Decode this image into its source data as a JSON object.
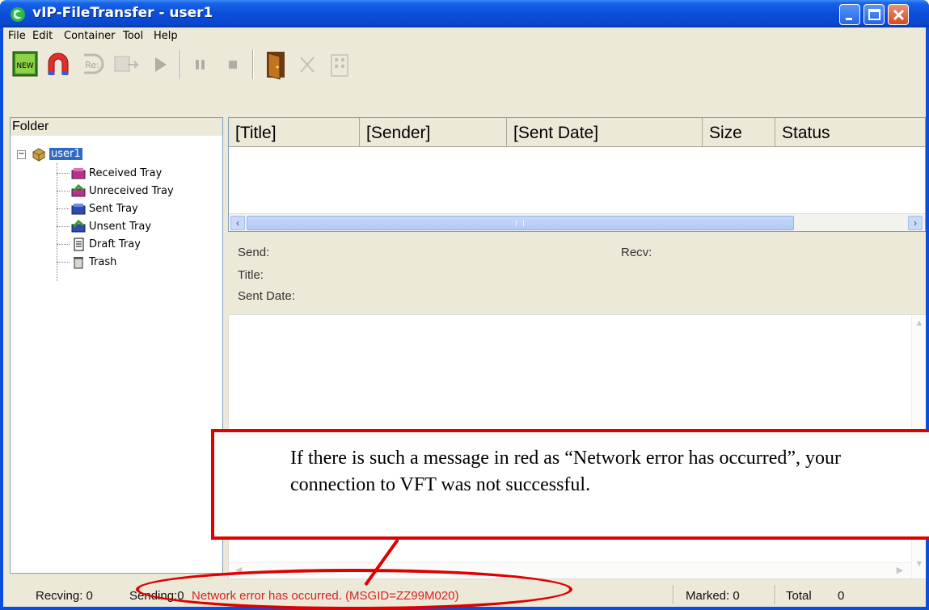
{
  "window": {
    "title": "vIP-FileTransfer - user1"
  },
  "menu": [
    "File",
    "Edit",
    "Container",
    "Tool",
    "Help"
  ],
  "toolbar": {
    "new_label": "NEW",
    "reply_label": "Re:"
  },
  "folder_pane": {
    "header": "Folder",
    "root": "user1",
    "items": [
      "Received Tray",
      "Unreceived Tray",
      "Sent Tray",
      "Unsent Tray",
      "Draft Tray",
      "Trash"
    ]
  },
  "list": {
    "columns": [
      "[Title]",
      "[Sender]",
      "[Sent Date]",
      "Size",
      "Status"
    ]
  },
  "details": {
    "send_label": "Send:",
    "recv_label": "Recv:",
    "title_label": "Title:",
    "sent_date_label": "Sent Date:"
  },
  "callout": {
    "text": "If there is such a message in red as “Network error has occurred”, your connection to VFT was not successful."
  },
  "statusbar": {
    "recving": "Recving: 0",
    "sending": "Sending:0",
    "error": "Network error has occurred. (MSGID=ZZ99M020)",
    "marked": "Marked: 0",
    "total_label": "Total",
    "total_value": "0"
  },
  "colors": {
    "title_bar": "#0b4ed8",
    "window_bg": "#ece9d8",
    "error_text": "#d42323",
    "annotation_red": "#e00000",
    "selection": "#316ac5"
  }
}
